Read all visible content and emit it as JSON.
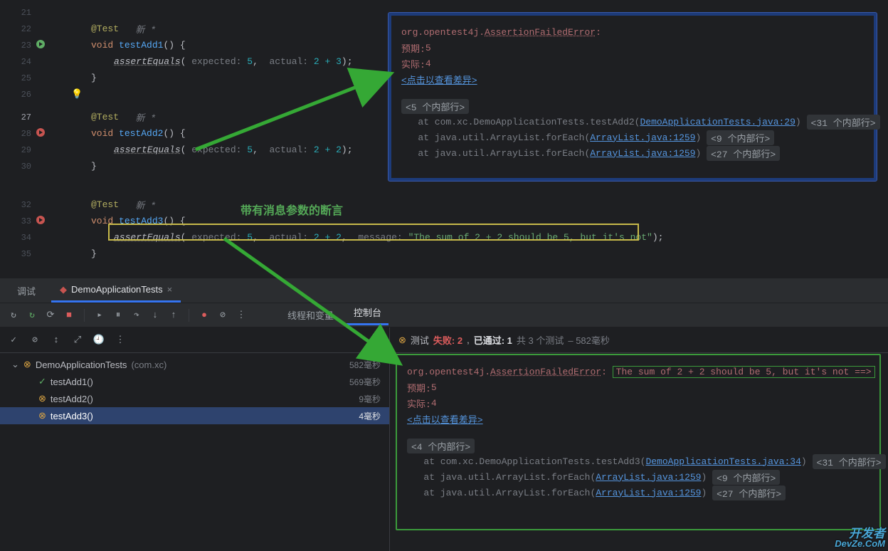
{
  "editor": {
    "lines": {
      "21": "",
      "22": {
        "ann": "@Test",
        "new": "新 *"
      },
      "23": {
        "kw": "void",
        "fn": "testAdd1",
        "tail": "() {"
      },
      "24": {
        "call": "assertEquals",
        "p1": "expected:",
        "v1": "5",
        "p2": "actual:",
        "v2": "2 + 3"
      },
      "25": "}",
      "26": "",
      "27": {
        "ann": "@Test",
        "new": "新 *"
      },
      "28": {
        "kw": "void",
        "fn": "testAdd2",
        "tail": "() {"
      },
      "29": {
        "call": "assertEquals",
        "p1": "expected:",
        "v1": "5",
        "p2": "actual:",
        "v2": "2 + 2"
      },
      "30": "}",
      "32": {
        "ann": "@Test",
        "new": "新 *"
      },
      "33": {
        "kw": "void",
        "fn": "testAdd3",
        "tail": "() {"
      },
      "34": {
        "call": "assertEquals",
        "p1": "expected:",
        "v1": "5",
        "p2": "actual:",
        "v2": "2 + 2",
        "p3": "message:",
        "msg": "\"The sum of 2 + 2 should be 5, but it's not\""
      },
      "35": "}"
    },
    "annotation": "带有消息参数的断言"
  },
  "panel": {
    "tab1": "调试",
    "tab2": "DemoApplicationTests",
    "sub1": "线程和变量",
    "sub2": "控制台"
  },
  "status": {
    "prefix": "测试",
    "fail_word": "失败: 2",
    "pass_word": "已通过: 1",
    "total": "共 3 个测试",
    "duration": "– 582毫秒"
  },
  "tree": {
    "root": "DemoApplicationTests",
    "root_pkg": "(com.xc)",
    "root_time": "582毫秒",
    "items": [
      {
        "name": "testAdd1()",
        "time": "569毫秒",
        "status": "pass"
      },
      {
        "name": "testAdd2()",
        "time": "9毫秒",
        "status": "fail"
      },
      {
        "name": "testAdd3()",
        "time": "4毫秒",
        "status": "fail",
        "sel": true
      }
    ]
  },
  "err_top": {
    "ns": "org.opentest4j.",
    "cls": "AssertionFailedError",
    "expect_lbl": "预期:",
    "expect_val": "5",
    "actual_lbl": "实际:",
    "actual_val": "4",
    "diff_link": "<点击以查看差异>",
    "internal5": "<5 个内部行>",
    "st1_pre": "at com.xc.DemoApplicationTests.testAdd2(",
    "st1_link": "DemoApplicationTests.java:29",
    "st1_post": ")",
    "st1_badge": "<31 个内部行>",
    "st2_pre": "at java.util.ArrayList.forEach(",
    "st2_link": "ArrayList.java:1259",
    "st2_post": ")",
    "st2_badge": "<9 个内部行>",
    "st3_pre": "at java.util.ArrayList.forEach(",
    "st3_link": "ArrayList.java:1259",
    "st3_post": ")",
    "st3_badge": "<27 个内部行>"
  },
  "err_bot": {
    "ns": "org.opentest4j.",
    "cls": "AssertionFailedError",
    "msg": "The sum of 2 + 2 should be 5, but it's not ==>",
    "expect_lbl": "预期:",
    "expect_val": "5",
    "actual_lbl": "实际:",
    "actual_val": "4",
    "diff_link": "<点击以查看差异>",
    "internal4": "<4 个内部行>",
    "st1_pre": "at com.xc.DemoApplicationTests.testAdd3(",
    "st1_link": "DemoApplicationTests.java:34",
    "st1_post": ")",
    "st1_badge": "<31 个内部行>",
    "st2_pre": "at java.util.ArrayList.forEach(",
    "st2_link": "ArrayList.java:1259",
    "st2_post": ")",
    "st2_badge": "<9 个内部行>",
    "st3_pre": "at java.util.ArrayList.forEach(",
    "st3_link": "ArrayList.java:1259",
    "st3_post": ")",
    "st3_badge": "<27 个内部行>"
  },
  "watermark": {
    "l1": "开发者",
    "l2": "DevZe.CoM"
  }
}
